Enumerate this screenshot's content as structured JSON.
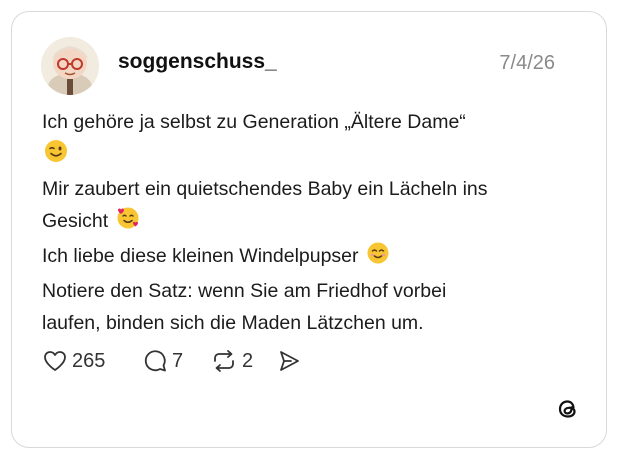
{
  "post": {
    "username": "soggenschuss_",
    "date": "7/4/26",
    "lines": [
      "Ich gehöre ja selbst zu Generation „Ältere Dame“",
      "",
      "Mir zaubert ein quietschendes Baby ein Lächeln ins",
      "Gesicht",
      "Ich liebe diese kleinen Windelpupser",
      "Notiere den Satz: wenn Sie am Friedhof vorbei",
      "laufen, binden sich die Maden Lätzchen um."
    ]
  },
  "actions": {
    "likes": "265",
    "replies": "7",
    "reposts": "2"
  },
  "icons": {
    "like": "heart-icon",
    "reply": "comment-icon",
    "repost": "repost-icon",
    "share": "send-icon",
    "brand": "threads-logo-icon"
  },
  "colors": {
    "border": "#d9d9d9",
    "text": "#1c1c1c",
    "muted": "#8a8a8a",
    "emoji": "#f7c632"
  }
}
